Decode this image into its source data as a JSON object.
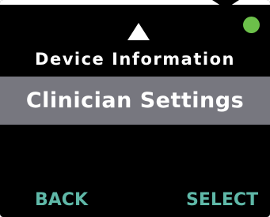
{
  "menu": {
    "previous_item": "Device Information",
    "selected_item": "Clinician Settings"
  },
  "softkeys": {
    "left_label": "BACK",
    "right_label": "SELECT"
  },
  "icons": {
    "scroll_up": "up-triangle-icon",
    "status": "status-dot-icon"
  },
  "colors": {
    "background": "#000000",
    "text": "#ffffff",
    "selection_highlight": "#77777f",
    "softkey_text": "#5fb8a8",
    "status_ok": "#6cc04a"
  }
}
